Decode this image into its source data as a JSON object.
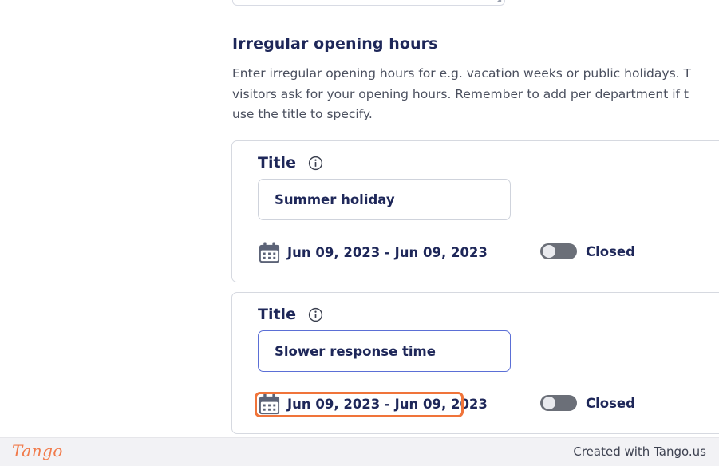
{
  "section": {
    "title": "Irregular opening hours",
    "description_lines": [
      "Enter irregular opening hours for e.g. vacation weeks or public holidays. T",
      "visitors ask for your opening hours. Remember to add per department if t",
      "use the title to specify."
    ]
  },
  "entries": [
    {
      "title_label": "Title",
      "title_value": "Summer holiday",
      "date_range": "Jun 09, 2023 - Jun 09, 2023",
      "toggle_label": "Closed",
      "toggle_on": false
    },
    {
      "title_label": "Title",
      "title_value": "Slower response time",
      "date_range": "Jun 09, 2023 - Jun 09, 2023",
      "toggle_label": "Closed",
      "toggle_on": false
    }
  ],
  "icons": {
    "info": "info-icon",
    "calendar": "calendar-icon"
  },
  "colors": {
    "heading": "#1e2759",
    "focus_border": "#5b6fd6",
    "highlight": "#f0743a",
    "toggle_off": "#6b6f78"
  },
  "footer": {
    "logo": "Tango",
    "credit": "Created with Tango.us"
  }
}
